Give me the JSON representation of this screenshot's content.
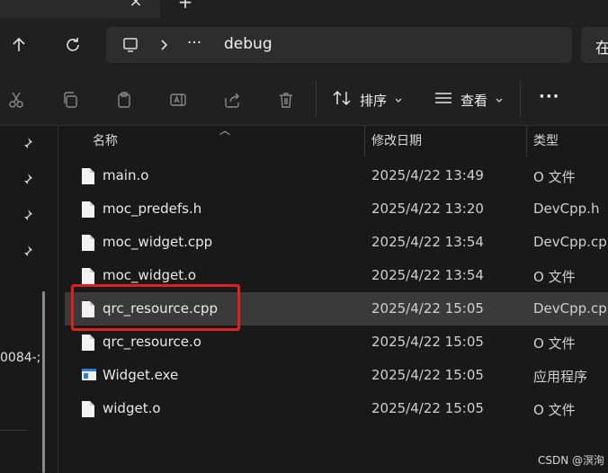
{
  "address": {
    "path_segment": "debug",
    "search_partial": "在",
    "ellipsis": "···"
  },
  "toolbar": {
    "sort_label": "排序",
    "view_label": "查看",
    "more_label": "···"
  },
  "columns": {
    "name": "名称",
    "date": "修改日期",
    "type": "类型"
  },
  "files": [
    {
      "name": "main.o",
      "date": "2025/4/22 13:49",
      "type": "O 文件",
      "icon": "file-icon"
    },
    {
      "name": "moc_predefs.h",
      "date": "2025/4/22 13:20",
      "type": "DevCpp.h",
      "icon": "file-icon"
    },
    {
      "name": "moc_widget.cpp",
      "date": "2025/4/22 13:54",
      "type": "DevCpp.cpp",
      "icon": "file-icon"
    },
    {
      "name": "moc_widget.o",
      "date": "2025/4/22 13:54",
      "type": "O 文件",
      "icon": "file-icon"
    },
    {
      "name": "qrc_resource.cpp",
      "date": "2025/4/22 15:05",
      "type": "DevCpp.cpp",
      "icon": "file-icon",
      "selected": true
    },
    {
      "name": "qrc_resource.o",
      "date": "2025/4/22 15:05",
      "type": "O 文件",
      "icon": "file-icon"
    },
    {
      "name": "Widget.exe",
      "date": "2025/4/22 15:05",
      "type": "应用程序",
      "icon": "exe-icon"
    },
    {
      "name": "widget.o",
      "date": "2025/4/22 15:05",
      "type": "O 文件",
      "icon": "file-icon"
    }
  ],
  "nav": {
    "truncated_text": "0084-;"
  },
  "watermark": "CSDN @溟洵",
  "colors": {
    "background": "#191919",
    "selection": "#3a3a3a",
    "highlight_box": "#e0201f"
  }
}
